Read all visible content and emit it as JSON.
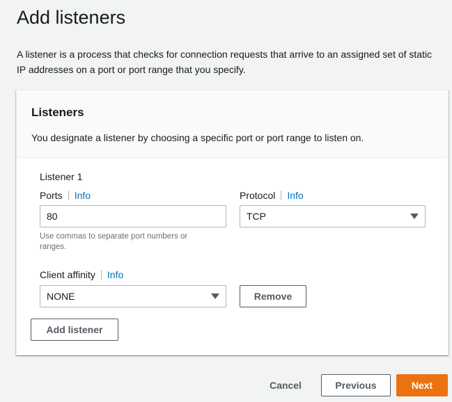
{
  "page": {
    "title": "Add listeners",
    "description": "A listener is a process that checks for connection requests that arrive to an assigned set of static IP addresses on a port or port range that you specify."
  },
  "panel": {
    "title": "Listeners",
    "description": "You designate a listener by choosing a specific port or port range to listen on."
  },
  "listener": {
    "heading": "Listener 1",
    "ports": {
      "label": "Ports",
      "info": "Info",
      "value": "80",
      "hint": "Use commas to separate port numbers or ranges."
    },
    "protocol": {
      "label": "Protocol",
      "info": "Info",
      "value": "TCP"
    },
    "client_affinity": {
      "label": "Client affinity",
      "info": "Info",
      "value": "NONE"
    },
    "remove_label": "Remove"
  },
  "add_listener_label": "Add listener",
  "footer": {
    "cancel_label": "Cancel",
    "previous_label": "Previous",
    "next_label": "Next"
  },
  "colors": {
    "accent": "#ec7211",
    "link": "#0073bb"
  }
}
